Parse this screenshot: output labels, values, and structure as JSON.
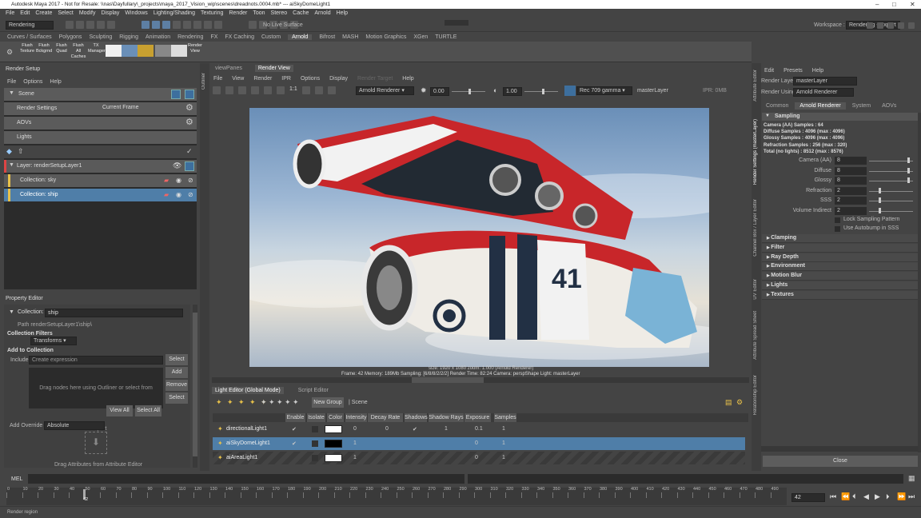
{
  "window": {
    "title": "Autodesk Maya 2017 - Not for Resale: \\\\nas\\Dayfullary\\_projects\\maya_2017_Vision_wip\\scenes\\dreadnots.0004.mb* --- aiSkyDomeLight1"
  },
  "menu": [
    "File",
    "Edit",
    "Create",
    "Select",
    "Modify",
    "Display",
    "Windows",
    "Lighting/Shading",
    "Texturing",
    "Render",
    "Toon",
    "Stereo",
    "Cache",
    "Arnold",
    "Help"
  ],
  "status_line": {
    "menu_set": "Rendering",
    "live_surface": "No Live Surface",
    "workspace_label": "Workspace :",
    "workspace": "Rendering - Expert"
  },
  "shelf_tabs": [
    "Curves / Surfaces",
    "Polygons",
    "Sculpting",
    "Rigging",
    "Animation",
    "Rendering",
    "FX",
    "FX Caching",
    "Custom",
    "Arnold",
    "Bifrost",
    "MASH",
    "Motion Graphics",
    "XGen",
    "TURTLE"
  ],
  "shelf_active": "Arnold",
  "shelf_buttons": [
    {
      "l1": "Flush",
      "l2": "Texture"
    },
    {
      "l1": "Flush",
      "l2": "Bckgrnd"
    },
    {
      "l1": "Flush",
      "l2": "Quad"
    },
    {
      "l1": "Flush",
      "l2": "All Caches"
    },
    {
      "l1": "TX",
      "l2": "Manager"
    },
    {
      "l1": "",
      "l2": ""
    },
    {
      "l1": "",
      "l2": ""
    },
    {
      "l1": "",
      "l2": ""
    },
    {
      "l1": "",
      "l2": ""
    },
    {
      "l1": "",
      "l2": ""
    },
    {
      "l1": "Render",
      "l2": "View"
    }
  ],
  "render_setup": {
    "title": "Render Setup",
    "menu": [
      "File",
      "Options",
      "Help"
    ],
    "scene": "Scene",
    "render_settings": "Render Settings",
    "current_frame": "Current Frame",
    "aovs": "AOVs",
    "lights": "Lights",
    "layer": "Layer:  renderSetupLayer1",
    "collections": [
      "Collection:  sky",
      "Collection:  ship"
    ]
  },
  "property_editor": {
    "title": "Property Editor",
    "collection_label": "Collection:",
    "collection_value": "ship",
    "path": "Path renderSetupLayer1\\ship\\",
    "filters_label": "Collection Filters",
    "filter_value": "Transforms",
    "add_label": "Add to Collection",
    "include_label": "Include",
    "include_placeholder": "Create expression",
    "select": "Select",
    "add": "Add",
    "remove": "Remove",
    "select2": "Select",
    "drag_text": "Drag nodes here using Outliner or select from Viewport",
    "view_all": "View All",
    "select_all": "Select All",
    "override_label": "Add Override",
    "override_value": "Absolute",
    "drag_attr": "Drag Attributes from Attribute Editor"
  },
  "outliner_label": "Outliner",
  "render_view": {
    "tabs": [
      "viewPanes",
      "Render View"
    ],
    "menu": [
      "File",
      "View",
      "Render",
      "IPR",
      "Options",
      "Display",
      "Render Target",
      "Help"
    ],
    "renderer": "Arnold Renderer",
    "exposure": "0.00",
    "gamma": "1.00",
    "colorspace": "Rec 709 gamma",
    "layer": "masterLayer",
    "ipr": "IPR: 0MB",
    "info": "size: 1920 x 1080  zoom: 1.000    (Arnold Renderer)",
    "stats": "Frame: 42    Memory: 189Mb    Sampling: [6/8/8/2/2/2]    Render Time: 82:24    Camera: perspShape    Light: masterLayer",
    "ship_number": "41"
  },
  "light_editor": {
    "tabs": [
      "Light Editor (Global Mode)",
      "Script Editor"
    ],
    "new_group": "New Group",
    "scene": "Scene",
    "columns": [
      "Enable",
      "Isolate",
      "Color",
      "Intensity",
      "Decay Rate",
      "Shadows",
      "Shadow Rays",
      "Exposure",
      "Samples"
    ],
    "rows": [
      {
        "name": "directionalLight1",
        "enable": "✔",
        "intensity": "0",
        "decay": "0",
        "shadows": "✔",
        "rays": "1",
        "exposure": "0.1",
        "samples": "1",
        "color": "#ffffff"
      },
      {
        "name": "aiSkyDomeLight1",
        "enable": "✔",
        "intensity": "1",
        "decay": "",
        "shadows": "",
        "rays": "",
        "exposure": "0",
        "samples": "1",
        "color": "#000000"
      },
      {
        "name": "aiAreaLight1",
        "enable": "",
        "intensity": "1",
        "decay": "",
        "shadows": "",
        "rays": "",
        "exposure": "0",
        "samples": "1",
        "color": "#ffffff"
      }
    ]
  },
  "attr_editor": {
    "menu": [
      "Edit",
      "Presets",
      "Help"
    ],
    "render_layer_label": "Render Layer",
    "render_layer": "masterLayer",
    "render_using_label": "Render Using",
    "render_using": "Arnold Renderer",
    "tabs": [
      "Common",
      "Arnold Renderer",
      "System",
      "AOVs"
    ],
    "sampling": "Sampling",
    "info": [
      "Camera (AA) Samples : 64",
      "Diffuse Samples : 4096 (max : 4096)",
      "Glossy Samples : 4096 (max : 4096)",
      "Refraction Samples : 256 (max : 320)",
      "Total (no lights) : 8512 (max : 8576)"
    ],
    "fields": [
      {
        "label": "Camera (AA)",
        "value": "8",
        "pos": 0.9
      },
      {
        "label": "Diffuse",
        "value": "8",
        "pos": 0.9
      },
      {
        "label": "Glossy",
        "value": "8",
        "pos": 0.9
      },
      {
        "label": "Refraction",
        "value": "2",
        "pos": 0.23
      },
      {
        "label": "SSS",
        "value": "2",
        "pos": 0.23
      },
      {
        "label": "Volume Indirect",
        "value": "2",
        "pos": 0.23
      }
    ],
    "checks": [
      "Lock Sampling Pattern",
      "Use Autobump in SSS"
    ],
    "sections": [
      "Clamping",
      "Filter",
      "Ray Depth",
      "Environment",
      "Motion Blur",
      "Lights",
      "Textures"
    ],
    "close": "Close"
  },
  "side_tabs": [
    "Attribute Editor",
    "Render Settings (masterLayer)",
    "Channel Box / Layer Editor",
    "UV Editor",
    "Attribute Spread Sheet",
    "Relationship Editor"
  ],
  "timeline": {
    "ticks": [
      "0",
      "10",
      "20",
      "30",
      "40",
      "50",
      "60",
      "70",
      "80",
      "90",
      "100",
      "110",
      "120",
      "130",
      "140",
      "150",
      "160",
      "170",
      "180",
      "190",
      "200",
      "210",
      "220",
      "230",
      "240",
      "250",
      "260",
      "270",
      "280",
      "290",
      "300",
      "310",
      "320",
      "330",
      "340",
      "350",
      "360",
      "370",
      "380",
      "390",
      "400",
      "410",
      "420",
      "430",
      "440",
      "450",
      "460",
      "470",
      "480",
      "490"
    ],
    "current": "42",
    "frame_field": "42"
  },
  "cmd": {
    "label": "MEL"
  },
  "help_line": "Render region"
}
